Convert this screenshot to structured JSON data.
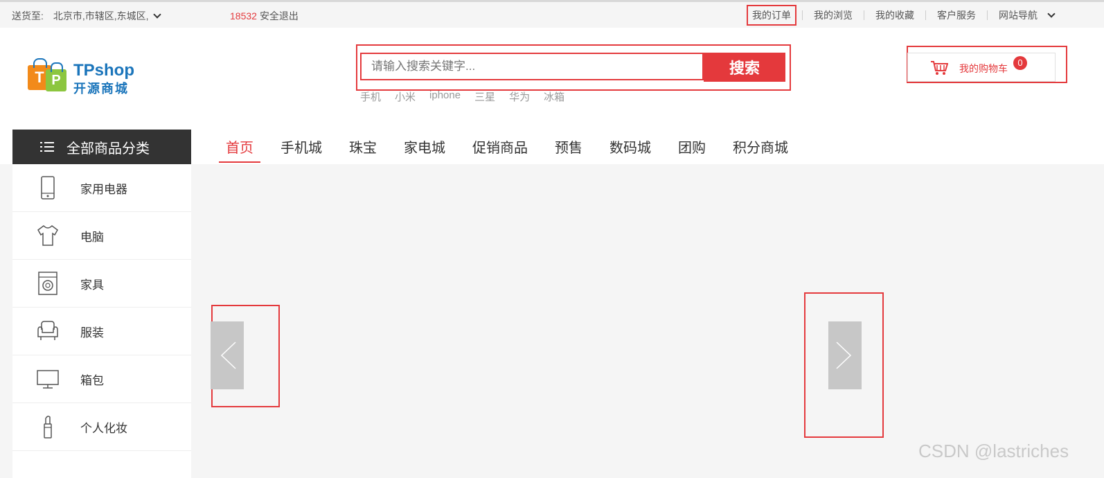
{
  "topbar": {
    "ship_label": "送货至:",
    "ship_region": "北京市,市辖区,东城区,",
    "user_id": "18532",
    "logout": "安全退出",
    "links": [
      "我的订单",
      "我的浏览",
      "我的收藏",
      "客户服务",
      "网站导航"
    ]
  },
  "logo": {
    "bag_letters": [
      "T",
      "P"
    ],
    "title": "TPshop",
    "subtitle": "开源商城"
  },
  "search": {
    "placeholder": "请输入搜索关键字...",
    "button": "搜索",
    "hot_words": [
      "手机",
      "小米",
      "iphone",
      "三星",
      "华为",
      "冰箱"
    ]
  },
  "cart": {
    "label": "我的购物车",
    "count": "0"
  },
  "nav": {
    "all_categories": "全部商品分类",
    "tabs": [
      "首页",
      "手机城",
      "珠宝",
      "家电城",
      "促销商品",
      "预售",
      "数码城",
      "团购",
      "积分商城"
    ]
  },
  "categories": [
    {
      "label": "家用电器",
      "icon": "phone-icon"
    },
    {
      "label": "电脑",
      "icon": "shirt-icon"
    },
    {
      "label": "家具",
      "icon": "washing-machine-icon"
    },
    {
      "label": "服装",
      "icon": "armchair-icon"
    },
    {
      "label": "箱包",
      "icon": "monitor-icon"
    },
    {
      "label": "个人化妆",
      "icon": "lipstick-icon"
    }
  ],
  "watermark": "CSDN @lastriches",
  "colors": {
    "accent": "#e4393c",
    "logo_blue": "#1b75bb",
    "dark": "#333333"
  }
}
